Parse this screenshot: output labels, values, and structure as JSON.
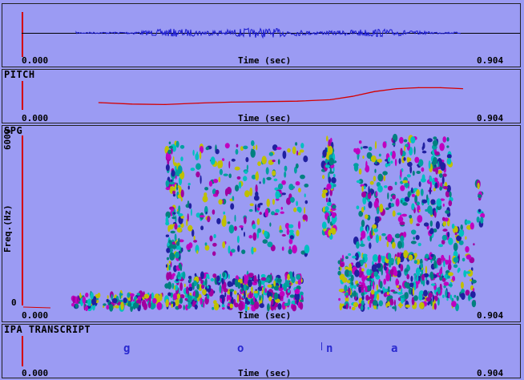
{
  "waveform": {
    "x_start": "0.000",
    "x_label": "Time (sec)",
    "x_end": "0.904",
    "colors": {
      "trace": "#1a1ad0",
      "baseline": "#000000"
    }
  },
  "pitch": {
    "title": "PITCH",
    "x_start": "0.000",
    "x_label": "Time (sec)",
    "x_end": "0.904",
    "colors": {
      "contour": "#d40000"
    }
  },
  "spectrogram": {
    "title": "SPG",
    "y_max": "6000",
    "y_min": "0",
    "y_label": "Freq.(Hz)",
    "x_start": "0.000",
    "x_label": "Time (sec)",
    "x_end": "0.904"
  },
  "transcript": {
    "title": "IPA TRANSCRIPT",
    "symbols": [
      "g",
      "o",
      "n",
      "a"
    ],
    "x_start": "0.000",
    "x_label": "Time (sec)",
    "x_end": "0.904"
  },
  "chart_data": {
    "type": "line",
    "title": "PITCH",
    "xlabel": "Time (sec)",
    "xlim": [
      0.0,
      0.904
    ],
    "series": [
      {
        "x": [
          0.14,
          0.2,
          0.26,
          0.32,
          0.38,
          0.44,
          0.5,
          0.56,
          0.6,
          0.64,
          0.68,
          0.72,
          0.76,
          0.8
        ],
        "values": [
          0.75,
          0.6,
          0.55,
          0.7,
          0.8,
          0.85,
          0.9,
          1.05,
          1.4,
          1.9,
          2.2,
          2.3,
          2.3,
          2.2
        ]
      }
    ]
  }
}
